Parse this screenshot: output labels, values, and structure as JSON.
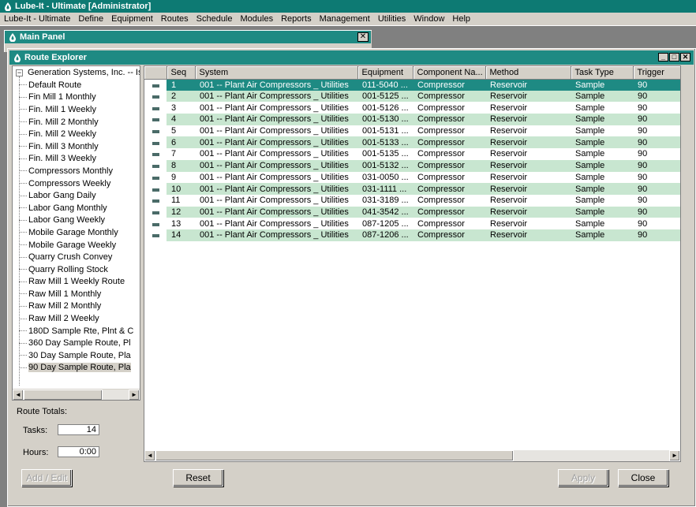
{
  "app": {
    "title": "Lube-It - Ultimate [Administrator]",
    "menu": [
      "Lube-It - Ultimate",
      "Define",
      "Equipment",
      "Routes",
      "Schedule",
      "Modules",
      "Reports",
      "Management",
      "Utilities",
      "Window",
      "Help"
    ]
  },
  "main_panel": {
    "title": "Main Panel",
    "close_glyph": "✕"
  },
  "route_explorer": {
    "title": "Route Explorer",
    "window_buttons": [
      "_",
      "□",
      "✕"
    ],
    "tree": {
      "expander": "−",
      "root": "Generation Systems, Inc. -- Is",
      "items": [
        "Default Route",
        "Fin Mill 1 Monthly",
        "Fin. Mill 1 Weekly",
        "Fin. Mill 2 Monthly",
        "Fin. Mill 2 Weekly",
        "Fin. Mill 3 Monthly",
        "Fin. Mill 3 Weekly",
        "Compressors Monthly",
        "Compressors Weekly",
        "Labor Gang Daily",
        "Labor Gang Monthly",
        "Labor Gang Weekly",
        "Mobile Garage Monthly",
        "Mobile Garage Weekly",
        "Quarry Crush Convey",
        "Quarry Rolling Stock",
        "Raw Mill 1 Weekly Route",
        "Raw Mill 1 Monthly",
        "Raw Mill 2 Monthly",
        "Raw Mill 2 Weekly",
        "180D Sample Rte, Plnt & C",
        "360 Day Sample Route, Pl",
        "30 Day Sample Route, Pla",
        "90 Day Sample Route, Pla"
      ],
      "selected_index": 23
    },
    "totals": {
      "title": "Route Totals:",
      "tasks_label": "Tasks:",
      "tasks_value": "14",
      "hours_label": "Hours:",
      "hours_value": "0:00"
    },
    "grid": {
      "columns": [
        "Seq",
        "System",
        "Equipment",
        "Component Na...",
        "Method",
        "Task Type",
        "Trigger"
      ],
      "rows": [
        [
          "1",
          "001 -- Plant Air Compressors _ Utilities",
          "011-5040 ...",
          "Compressor",
          "Reservoir",
          "Sample",
          "90"
        ],
        [
          "2",
          "001 -- Plant Air Compressors _ Utilities",
          "001-5125 ...",
          "Compressor",
          "Reservoir",
          "Sample",
          "90"
        ],
        [
          "3",
          "001 -- Plant Air Compressors _ Utilities",
          "001-5126 ...",
          "Compressor",
          "Reservoir",
          "Sample",
          "90"
        ],
        [
          "4",
          "001 -- Plant Air Compressors _ Utilities",
          "001-5130 ...",
          "Compressor",
          "Reservoir",
          "Sample",
          "90"
        ],
        [
          "5",
          "001 -- Plant Air Compressors _ Utilities",
          "001-5131 ...",
          "Compressor",
          "Reservoir",
          "Sample",
          "90"
        ],
        [
          "6",
          "001 -- Plant Air Compressors _ Utilities",
          "001-5133 ...",
          "Compressor",
          "Reservoir",
          "Sample",
          "90"
        ],
        [
          "7",
          "001 -- Plant Air Compressors _ Utilities",
          "001-5135 ...",
          "Compressor",
          "Reservoir",
          "Sample",
          "90"
        ],
        [
          "8",
          "001 -- Plant Air Compressors _ Utilities",
          "001-5132 ...",
          "Compressor",
          "Reservoir",
          "Sample",
          "90"
        ],
        [
          "9",
          "001 -- Plant Air Compressors _ Utilities",
          "031-0050 ...",
          "Compressor",
          "Reservoir",
          "Sample",
          "90"
        ],
        [
          "10",
          "001 -- Plant Air Compressors _ Utilities",
          "031-1111 ...",
          "Compressor",
          "Reservoir",
          "Sample",
          "90"
        ],
        [
          "11",
          "001 -- Plant Air Compressors _ Utilities",
          "031-3189 ...",
          "Compressor",
          "Reservoir",
          "Sample",
          "90"
        ],
        [
          "12",
          "001 -- Plant Air Compressors _ Utilities",
          "041-3542 ...",
          "Compressor",
          "Reservoir",
          "Sample",
          "90"
        ],
        [
          "13",
          "001 -- Plant Air Compressors _ Utilities",
          "087-1205 ...",
          "Compressor",
          "Reservoir",
          "Sample",
          "90"
        ],
        [
          "14",
          "001 -- Plant Air Compressors _ Utilities",
          "087-1206 ...",
          "Compressor",
          "Reservoir",
          "Sample",
          "90"
        ]
      ],
      "selected_row": 0
    },
    "buttons": {
      "add_edit": "Add / Edit",
      "reset": "Reset",
      "apply": "Apply",
      "close": "Close"
    },
    "scroll_arrows": {
      "left": "◄",
      "right": "►"
    }
  },
  "colors": {
    "title_bar": "#1e8a83",
    "row_alt": "#c8e6d0",
    "row_selected": "#1e8a83"
  },
  "icons": [
    "lube-it-logo-icon",
    "close-icon",
    "minimize-icon",
    "maximize-icon",
    "row-indicator-icon"
  ]
}
